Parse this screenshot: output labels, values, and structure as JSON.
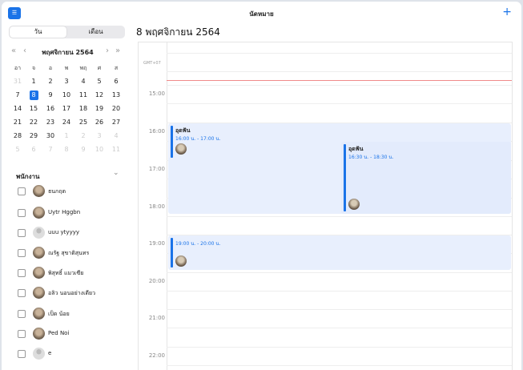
{
  "window": {
    "title": "นัดหมาย"
  },
  "toolbar": {
    "app_icon": "calendar-search-icon",
    "add_icon": "plus-icon",
    "add_label": "+"
  },
  "view_toggle": {
    "day_label": "วัน",
    "month_label": "เดือน",
    "selected": "day"
  },
  "header": {
    "date_title": "8 พฤศจิกายน 2564"
  },
  "mini_calendar": {
    "month_label": "พฤศจิกายน 2564",
    "prev_year": "«",
    "prev_month": "‹",
    "next_month": "›",
    "next_year": "»",
    "weekdays": [
      "อา",
      "จ",
      "อ",
      "พ",
      "พฤ",
      "ศ",
      "ส"
    ],
    "weeks": [
      [
        "31",
        "1",
        "2",
        "3",
        "4",
        "5",
        "6"
      ],
      [
        "7",
        "8",
        "9",
        "10",
        "11",
        "12",
        "13"
      ],
      [
        "14",
        "15",
        "16",
        "17",
        "18",
        "19",
        "20"
      ],
      [
        "21",
        "22",
        "23",
        "24",
        "25",
        "26",
        "27"
      ],
      [
        "28",
        "29",
        "30",
        "1",
        "2",
        "3",
        "4"
      ],
      [
        "5",
        "6",
        "7",
        "8",
        "9",
        "10",
        "11"
      ]
    ],
    "selected": "8"
  },
  "employees": {
    "title": "พนักงาน",
    "items": [
      {
        "name": "ธนกฤต",
        "has_photo": true
      },
      {
        "name": "Uytr Hggbn",
        "has_photo": true
      },
      {
        "name": "uuu ytyyyy",
        "has_photo": false
      },
      {
        "name": "ณรัฐ สุขาติสุนทร",
        "has_photo": true
      },
      {
        "name": "พิสุทธิ์ แมวเซีย",
        "has_photo": true
      },
      {
        "name": "อลิว นอนอย่างเดียว",
        "has_photo": true
      },
      {
        "name": "เป็ด น้อย",
        "has_photo": true
      },
      {
        "name": "Ped Noi",
        "has_photo": true
      },
      {
        "name": "e",
        "has_photo": false
      }
    ]
  },
  "day_view": {
    "timezone": "GMT+07",
    "hours": [
      "15:00",
      "16:00",
      "17:00",
      "18:00",
      "19:00",
      "20:00",
      "21:00",
      "22:00"
    ],
    "events": [
      {
        "title": "อุดฟัน",
        "time": "16:00 น. - 17:00 น."
      },
      {
        "title": "อุดฟัน",
        "time": "16:30 น. - 18:30 น."
      },
      {
        "title": "",
        "time": "19:00 น. - 20:00 น."
      }
    ]
  },
  "colors": {
    "accent": "#1a73e8",
    "event_bg": "#e8effd",
    "now_line": "#f08a8a"
  }
}
